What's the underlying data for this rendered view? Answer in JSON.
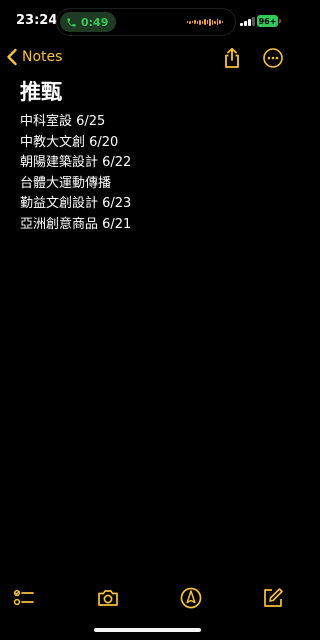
{
  "status_bar": {
    "time": "23:24",
    "call_timer": "0:49",
    "battery_level": "96+"
  },
  "nav": {
    "back_label": "Notes"
  },
  "note": {
    "title": "推甄",
    "lines": [
      "中科室設 6/25",
      "中教大文創 6/20",
      "朝陽建築設計 6/22",
      "台體大運動傳播",
      "勤益文創設計 6/23",
      "亞洲創意商品 6/21"
    ]
  },
  "colors": {
    "accent": "#f7c23b",
    "call_green": "#34c759",
    "background": "#000000",
    "text": "#ffffff"
  },
  "icons": {
    "back": "chevron-left-icon",
    "share": "share-icon",
    "more": "more-icon",
    "checklist": "checklist-icon",
    "camera": "camera-icon",
    "markup": "markup-icon",
    "compose": "compose-icon"
  }
}
